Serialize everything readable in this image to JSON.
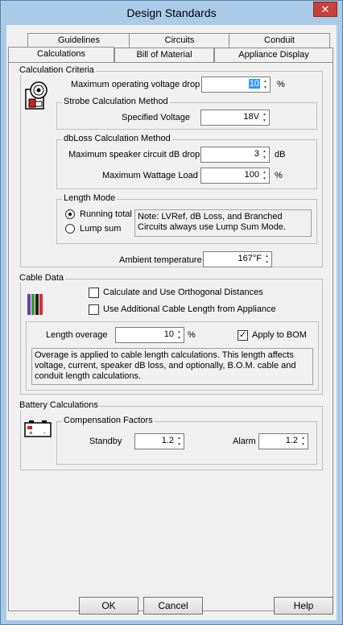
{
  "window": {
    "title": "Design Standards",
    "close_glyph": "✕"
  },
  "tabs": {
    "row1": [
      "Guidelines",
      "Circuits",
      "Conduit"
    ],
    "row2": [
      "Calculations",
      "Bill of Material",
      "Appliance Display"
    ],
    "active": "Calculations"
  },
  "calc": {
    "group": "Calculation Criteria",
    "max_voltage_drop_label": "Maximum operating voltage drop",
    "max_voltage_drop_value": "10",
    "max_voltage_drop_unit": "%",
    "strobe": {
      "group": "Strobe Calculation Method",
      "specified_voltage_label": "Specified Voltage",
      "specified_voltage_value": "18V"
    },
    "dbloss": {
      "group": "dbLoss Calculation Method",
      "max_db_drop_label": "Maximum speaker circuit dB drop",
      "max_db_drop_value": "3",
      "max_db_drop_unit": "dB",
      "max_wattage_label": "Maximum Wattage Load",
      "max_wattage_value": "100",
      "max_wattage_unit": "%"
    },
    "length_mode": {
      "group": "Length Mode",
      "running_total": "Running total",
      "lump_sum": "Lump sum",
      "selected": "Running total",
      "note": "Note: LVRef, dB Loss, and Branched Circuits always use Lump Sum Mode."
    },
    "ambient_label": "Ambient temperature",
    "ambient_value": "167°F"
  },
  "cable": {
    "group": "Cable Data",
    "orthogonal_label": "Calculate and Use Orthogonal Distances",
    "orthogonal_checked": false,
    "additional_label": "Use Additional Cable Length from Appliance",
    "additional_checked": false,
    "length_overage_label": "Length overage",
    "length_overage_value": "10",
    "length_overage_unit": "%",
    "apply_bom_label": "Apply to BOM",
    "apply_bom_checked": true,
    "apply_bom_glyph": "✓",
    "description": "Overage is applied to cable length calculations. This length affects voltage, current, speaker dB loss, and optionally, B.O.M. cable and conduit length calculations."
  },
  "battery": {
    "group": "Battery Calculations",
    "comp_group": "Compensation Factors",
    "standby_label": "Standby",
    "standby_value": "1.2",
    "alarm_label": "Alarm",
    "alarm_value": "1.2"
  },
  "buttons": {
    "ok": "OK",
    "cancel": "Cancel",
    "help": "Help"
  }
}
